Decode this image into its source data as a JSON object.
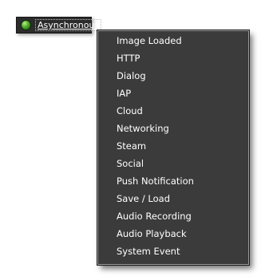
{
  "trigger": {
    "icon": "globe-icon",
    "label": "Asynchronous"
  },
  "menu": {
    "items": [
      {
        "label": "Image Loaded"
      },
      {
        "label": "HTTP"
      },
      {
        "label": "Dialog"
      },
      {
        "label": "IAP"
      },
      {
        "label": "Cloud"
      },
      {
        "label": "Networking"
      },
      {
        "label": "Steam"
      },
      {
        "label": "Social"
      },
      {
        "label": "Push Notification"
      },
      {
        "label": "Save / Load"
      },
      {
        "label": "Audio Recording"
      },
      {
        "label": "Audio Playback"
      },
      {
        "label": "System Event"
      }
    ]
  },
  "colors": {
    "menu_background": "#3b3b3b",
    "button_background": "#2c2c2c",
    "text": "#ffffff",
    "icon_green": "#58b030"
  }
}
